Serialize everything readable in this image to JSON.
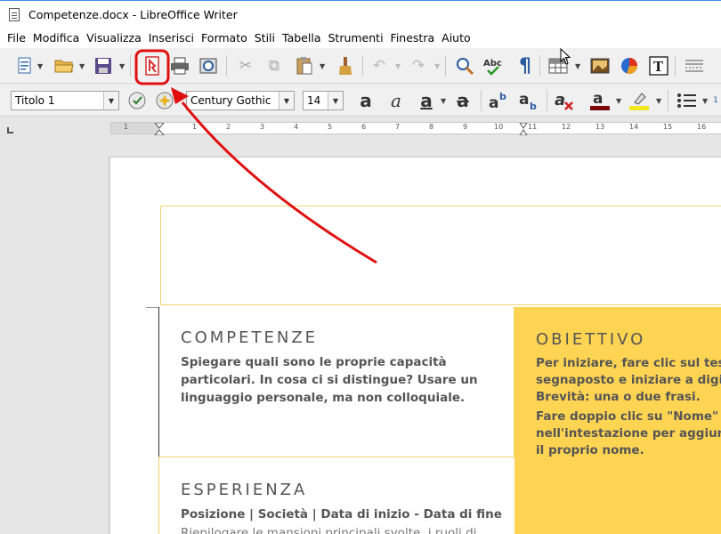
{
  "window": {
    "title": "Competenze.docx - LibreOffice Writer"
  },
  "menu": [
    "File",
    "Modifica",
    "Visualizza",
    "Inserisci",
    "Formato",
    "Stili",
    "Tabella",
    "Strumenti",
    "Finestra",
    "Aiuto"
  ],
  "toolbar2": {
    "paragraph_style": "Titolo 1",
    "font_name": "Century Gothic",
    "font_size": "14"
  },
  "ruler": {
    "labels": [
      "1",
      "1",
      "2",
      "3",
      "4",
      "5",
      "6",
      "7",
      "8",
      "9",
      "10",
      "11",
      "12",
      "13",
      "14",
      "15",
      "16"
    ]
  },
  "document": {
    "skills": {
      "title": "COMPETENZE",
      "text_lines": [
        "Spiegare quali sono le proprie capacità",
        "particolari. In cosa ci si distingue? Usare un",
        "linguaggio personale, ma non colloquiale."
      ]
    },
    "objective": {
      "title": "OBIETTIVO",
      "text_lines": [
        "Per iniziare, fare clic sul testo",
        "segnaposto e iniziare a digita",
        "Brevità: una o due frasi.",
        "Fare doppio clic su \"Nome\"",
        "nell'intestazione per aggiunge",
        "il proprio nome."
      ]
    },
    "experience": {
      "title": "ESPERIENZA",
      "line1": "Posizione | Società | Data di inizio - Data di fine",
      "line2": "Riepilogare le mansioni principali svolte, i ruoli di"
    }
  },
  "colors": {
    "annotation": "#e01010",
    "accent_yellow": "#ffd452",
    "border_yellow": "#f3d46c",
    "pdf_red": "#d32f2f"
  }
}
